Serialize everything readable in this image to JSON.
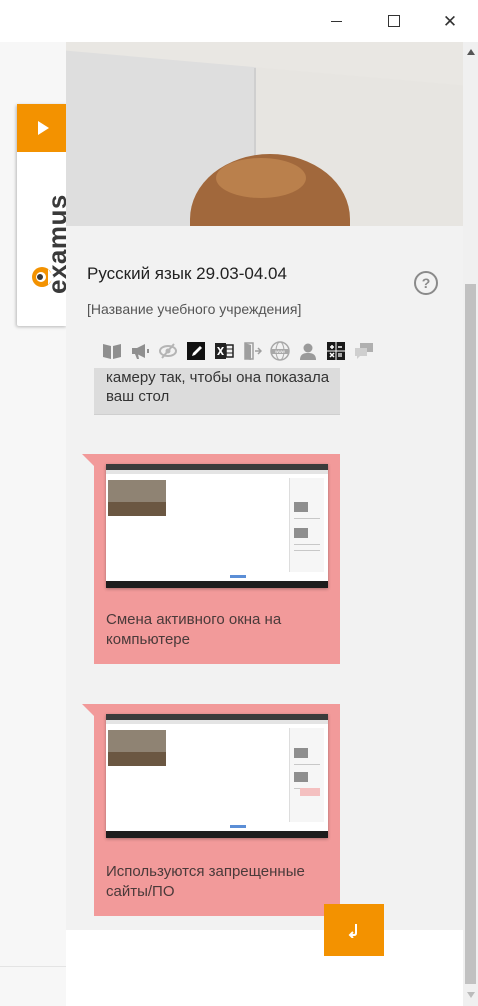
{
  "window": {
    "minimize_icon": "minimize-icon",
    "maximize_icon": "maximize-icon",
    "close_symbol": "✕"
  },
  "brand": {
    "name": "examus",
    "accent_color": "#f39200"
  },
  "exam": {
    "title": "Русский язык 29.03-04.04",
    "institution": "[Название учебного учреждения]"
  },
  "toolbar": {
    "icons": [
      "book-icon",
      "megaphone-icon",
      "hidden-eye-icon",
      "notepad-icon",
      "excel-icon",
      "exit-door-icon",
      "www-icon",
      "person-icon",
      "calculator-icon",
      "chat-icon"
    ]
  },
  "feed": {
    "system_message": "камеру так, чтобы она показала ваш стол",
    "violations": [
      {
        "text": "Смена активного окна на компьютере"
      },
      {
        "text": "Используются запрещенные сайты/ПО"
      }
    ],
    "violation_color": "#f29a9a"
  },
  "footer": {
    "send_icon": "send-icon"
  }
}
